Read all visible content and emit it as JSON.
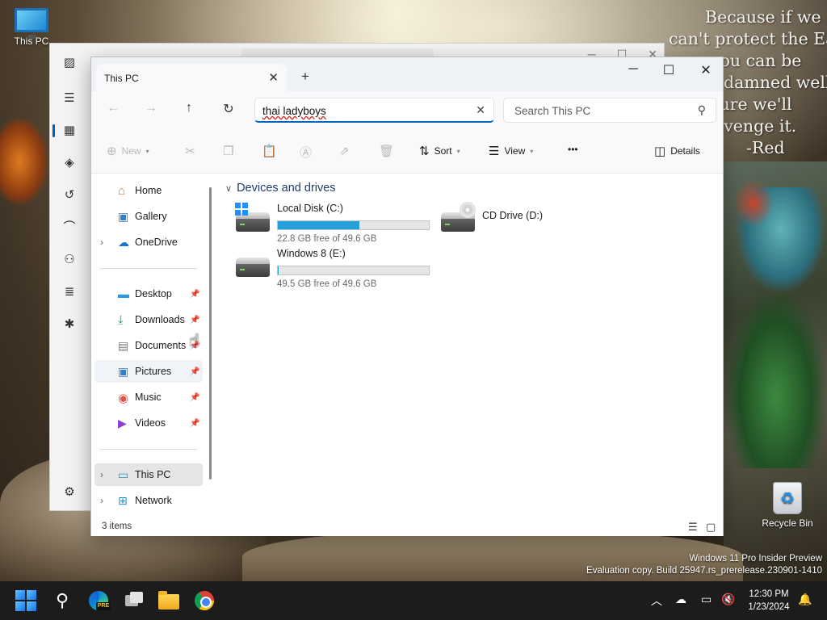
{
  "desktop": {
    "quote_lines": [
      "Because if we",
      "can't protect the Earth,",
      "you can be",
      "damned well",
      "sure we'll",
      "avenge it.",
      "-Red"
    ],
    "icons": [
      {
        "label": "This PC",
        "icon": "monitor-icon"
      },
      {
        "label": "Recycle Bin",
        "icon": "recycle-bin-icon"
      }
    ],
    "watermark": {
      "line1": "Windows 11 Pro Insider Preview",
      "line2": "Evaluation copy. Build 25947.rs_prerelease.230901-1410"
    }
  },
  "explorer": {
    "tab_title": "This PC",
    "new_tab_symbol": "+",
    "address_value": "thai ladyboys",
    "search_placeholder": "Search This PC",
    "commands": {
      "new": "New",
      "sort": "Sort",
      "view": "View",
      "more": "•••",
      "details": "Details"
    },
    "nav_pane": {
      "quick": [
        {
          "label": "Home",
          "icon": "home-icon"
        },
        {
          "label": "Gallery",
          "icon": "gallery-icon"
        },
        {
          "label": "OneDrive",
          "icon": "onedrive-icon"
        }
      ],
      "pinned": [
        {
          "label": "Desktop",
          "icon": "desktop-icon"
        },
        {
          "label": "Downloads",
          "icon": "downloads-icon"
        },
        {
          "label": "Documents",
          "icon": "documents-icon"
        },
        {
          "label": "Pictures",
          "icon": "pictures-icon"
        },
        {
          "label": "Music",
          "icon": "music-icon"
        },
        {
          "label": "Videos",
          "icon": "videos-icon"
        }
      ],
      "locations": [
        {
          "label": "This PC",
          "icon": "this-pc-icon"
        },
        {
          "label": "Network",
          "icon": "network-icon"
        }
      ]
    },
    "group_title": "Devices and drives",
    "drives": [
      {
        "name": "Local Disk (C:)",
        "free_text": "22.8 GB free of 49.6 GB",
        "used_fraction": 0.54,
        "icon": "windows-drive-icon"
      },
      {
        "name": "CD Drive (D:)",
        "icon": "cd-drive-icon"
      },
      {
        "name": "Windows 8 (E:)",
        "free_text": "49.5 GB free of 49.6 GB",
        "used_fraction": 0.002,
        "icon": "hard-drive-icon"
      }
    ],
    "status": "3 items"
  },
  "taskbar": {
    "time": "12:30 PM",
    "date": "1/23/2024",
    "edge_badge": "PRE"
  },
  "colors": {
    "accent": "#0067c0",
    "drive_fill": "#26a0da",
    "taskbar": "#1c1c1c"
  }
}
